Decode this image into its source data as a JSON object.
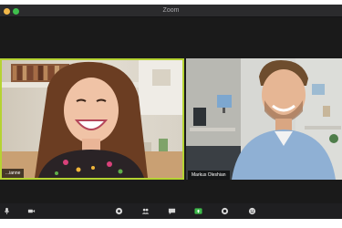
{
  "window": {
    "title": "Zoom"
  },
  "participants": [
    {
      "name": "...ianne",
      "active_speaker": true
    },
    {
      "name": "Markus Oleshian",
      "active_speaker": false
    }
  ],
  "toolbar": {
    "buttons": [
      {
        "icon": "microphone-icon"
      },
      {
        "icon": "video-camera-icon"
      },
      {
        "icon": "security-icon"
      },
      {
        "icon": "participants-icon"
      },
      {
        "icon": "chat-icon"
      },
      {
        "icon": "share-screen-icon"
      },
      {
        "icon": "record-icon"
      },
      {
        "icon": "reactions-icon"
      }
    ]
  },
  "colors": {
    "active_speaker_border": "#b5d332",
    "share_screen": "#3dbb4a",
    "window_chrome": "#2b2b2d",
    "stage_background": "#1a1a1a"
  }
}
